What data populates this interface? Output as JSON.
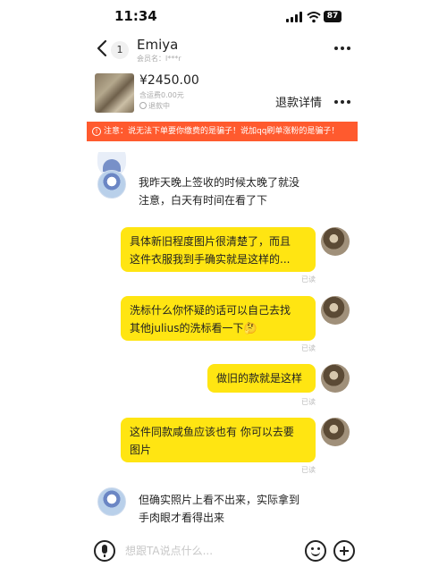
{
  "status_bar": {
    "time": "11:34",
    "battery": "87"
  },
  "header": {
    "unread_count": "1",
    "contact_name": "Emiya",
    "member_label": "会员名：l***r"
  },
  "order": {
    "price": "¥2450.00",
    "shipping": "含运费0.00元",
    "status": "退款中",
    "refund_details": "退款详情"
  },
  "warning": "注意：说无法下单要你缴费的是骗子！说加qq刷单涨粉的是骗子！",
  "messages": [
    {
      "sender": "other",
      "lines": [
        "我昨天晚上签收的时候太晚了就没",
        "注意，白天有时间在看了下"
      ]
    },
    {
      "sender": "self",
      "lines": [
        "具体新旧程度图片很清楚了，而且",
        "这件衣服我到手确实就是这样的..."
      ],
      "read": "已读"
    },
    {
      "sender": "self",
      "lines": [
        "洗标什么你怀疑的话可以自己去找",
        "其他julius的洗标看一下🤔"
      ],
      "read": "已读"
    },
    {
      "sender": "self",
      "lines": [
        "做旧的款就是这样"
      ],
      "read": "已读"
    },
    {
      "sender": "self",
      "lines": [
        "这件同款咸鱼应该也有 你可以去要",
        "图片"
      ],
      "read": "已读"
    },
    {
      "sender": "other",
      "lines": [
        "但确实照片上看不出来，实际拿到",
        "手肉眼才看得出来"
      ]
    }
  ],
  "input": {
    "placeholder": "想跟TA说点什么..."
  },
  "colors": {
    "bubble": "#ffe512",
    "warning": "#ff5a2e"
  },
  "icons": {
    "back": "chevron-left-icon",
    "more": "more-dots-icon",
    "voice": "microphone-icon",
    "emoji": "emoji-icon",
    "plus": "plus-icon"
  }
}
